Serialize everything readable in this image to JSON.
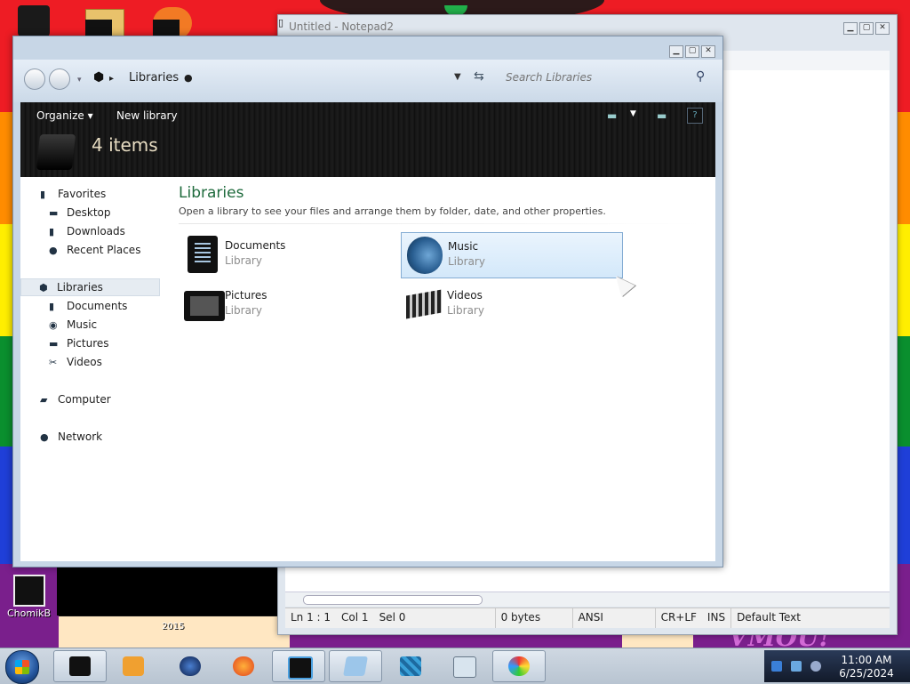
{
  "desktop": {
    "icon_label": "ChomikB",
    "year_label": "2015",
    "graffiti": "VMOU!"
  },
  "notepad": {
    "title": "Untitled - Notepad2",
    "status": {
      "position": "Ln 1 : 1",
      "col": "Col 1",
      "sel": "Sel 0",
      "size": "0 bytes",
      "encoding": "ANSI",
      "line_endings": "CR+LF",
      "mode": "INS",
      "scheme": "Default Text"
    }
  },
  "explorer": {
    "address": "Libraries",
    "search_placeholder": "Search Libraries",
    "toolbar": {
      "organize": "Organize",
      "new_library": "New library",
      "count": "4 items"
    },
    "nav": [
      {
        "label": "Favorites",
        "icon": "star-icon"
      },
      {
        "label": "Desktop",
        "icon": "desktop-icon"
      },
      {
        "label": "Downloads",
        "icon": "download-icon"
      },
      {
        "label": "Recent Places",
        "icon": "recent-icon"
      },
      {
        "label": "Libraries",
        "icon": "library-icon"
      },
      {
        "label": "Documents",
        "icon": "documents-icon"
      },
      {
        "label": "Music",
        "icon": "music-icon"
      },
      {
        "label": "Pictures",
        "icon": "pictures-icon"
      },
      {
        "label": "Videos",
        "icon": "videos-icon"
      },
      {
        "label": "Computer",
        "icon": "computer-icon"
      },
      {
        "label": "Network",
        "icon": "network-icon"
      }
    ],
    "content": {
      "title": "Libraries",
      "description": "Open a library to see your files and arrange them by folder, date, and other properties.",
      "libraries": [
        {
          "name": "Documents",
          "type": "Library"
        },
        {
          "name": "Music",
          "type": "Library"
        },
        {
          "name": "Pictures",
          "type": "Library"
        },
        {
          "name": "Videos",
          "type": "Library"
        }
      ]
    }
  },
  "taskbar": {
    "clock_time": "11:00 AM",
    "clock_date": "6/25/2024"
  },
  "colors": {
    "accent_title": "#1f6b3d",
    "selection_border": "#84acd3",
    "toolbar_bg": "#141414"
  }
}
